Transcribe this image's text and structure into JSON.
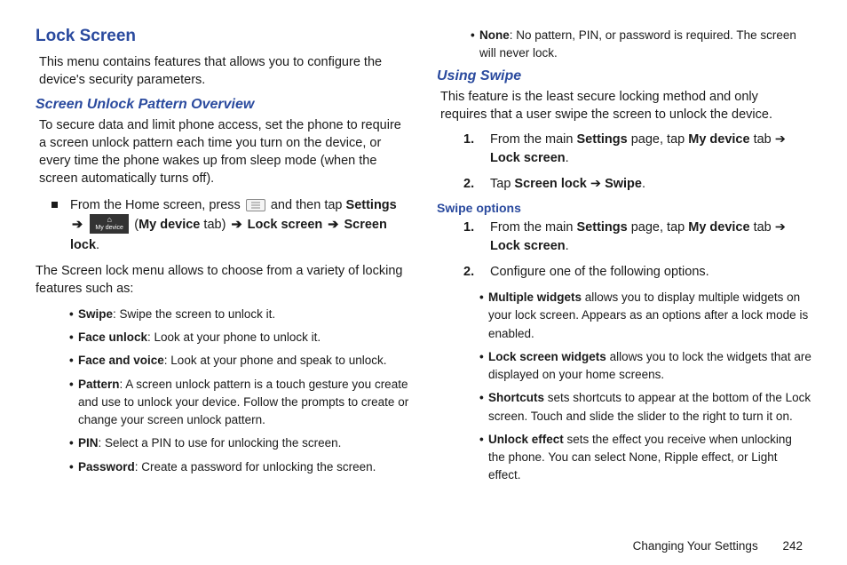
{
  "col1": {
    "title": "Lock Screen",
    "intro": "This menu contains features that allows you to configure the device's security parameters.",
    "h2": "Screen Unlock Pattern Overview",
    "para1": "To secure data and limit phone access, set the phone to require a screen unlock pattern each time you turn on the device, or every time the phone wakes up from sleep mode (when the screen automatically turns off).",
    "nav_prefix": "From the Home screen, press ",
    "nav_mid1": " and then tap ",
    "nav_settings": "Settings",
    "nav_mid2": " (",
    "nav_mydevice_tab": "My device",
    "nav_mid3": " tab) ",
    "nav_lockscreen": "Lock screen",
    "nav_screenlock": "Screen lock",
    "device_icon_label": "My device",
    "para2": "The Screen lock menu allows to choose from a variety of locking features such as:",
    "bullets": [
      {
        "k": "Swipe",
        "v": ": Swipe the screen to unlock it."
      },
      {
        "k": "Face unlock",
        "v": ": Look at your phone to unlock it."
      },
      {
        "k": "Face and voice",
        "v": ": Look at your phone and speak to unlock."
      },
      {
        "k": "Pattern",
        "v": ": A screen unlock pattern is a touch gesture you create and use to unlock your device. Follow the prompts to create or change your screen unlock pattern."
      },
      {
        "k": "PIN",
        "v": ": Select a PIN to use for unlocking the screen."
      },
      {
        "k": "Password",
        "v": ": Create a password for unlocking the screen."
      }
    ]
  },
  "col2": {
    "top_bullet": {
      "k": "None",
      "v": ": No pattern, PIN, or password is required. The screen will never lock."
    },
    "h2": "Using Swipe",
    "para1": "This feature is the least secure locking method and only requires that a user swipe the screen to unlock the device.",
    "steps1": [
      {
        "pre": "From the main ",
        "b1": "Settings",
        "mid1": " page, tap ",
        "b2": "My device",
        "mid2": " tab ➔ ",
        "b3": "Lock screen",
        "post": "."
      },
      {
        "pre": "Tap ",
        "b1": "Screen lock",
        "mid1": " ➔ ",
        "b2": "Swipe",
        "post": "."
      }
    ],
    "h3": "Swipe options",
    "steps2": [
      {
        "pre": "From the main ",
        "b1": "Settings",
        "mid1": " page, tap ",
        "b2": "My device",
        "mid2": " tab ➔ ",
        "b3": "Lock screen",
        "post": "."
      },
      {
        "pre": "Configure one of the following options."
      }
    ],
    "sub_bullets": [
      {
        "k": "Multiple widgets",
        "v": " allows you to display multiple widgets on your lock screen. Appears as an options after a lock mode is enabled."
      },
      {
        "k": "Lock screen widgets",
        "v": " allows you to lock the widgets that are displayed on your home screens."
      },
      {
        "k": "Shortcuts",
        "v": " sets shortcuts to appear at the bottom of the Lock screen. Touch and slide the slider to the right to turn it on."
      },
      {
        "k": "Unlock effect",
        "v": " sets the effect you receive when unlocking the phone. You can select None, Ripple effect, or Light effect."
      }
    ]
  },
  "footer": {
    "section": "Changing Your Settings",
    "page": "242"
  }
}
